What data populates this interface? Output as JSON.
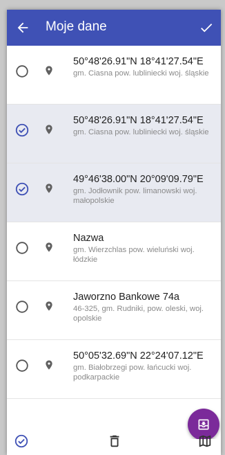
{
  "header": {
    "title": "Moje dane"
  },
  "locations": [
    {
      "title": "50°48'26.91\"N 18°41'27.54\"E",
      "subtitle": "gm. Ciasna pow. lubliniecki woj. śląskie",
      "selected": false
    },
    {
      "title": "50°48'26.91\"N 18°41'27.54\"E",
      "subtitle": "gm. Ciasna pow. lubliniecki woj. śląskie",
      "selected": true
    },
    {
      "title": "49°46'38.00\"N 20°09'09.79\"E",
      "subtitle": "gm. Jodłownik pow. limanowski woj. małopolskie",
      "selected": true
    },
    {
      "title": "Nazwa",
      "subtitle": "gm. Wierzchlas pow. wieluński woj. łódzkie",
      "selected": false
    },
    {
      "title": "Jaworzno Bankowe 74a",
      "subtitle": "46-325, gm. Rudniki, pow. oleski, woj. opolskie",
      "selected": false
    },
    {
      "title": "50°05'32.69\"N 22°24'07.12\"E",
      "subtitle": "gm. Białobrzegi pow. łańcucki woj. podkarpackie",
      "selected": false
    }
  ],
  "icons": {
    "back": "arrow-back-icon",
    "confirm": "check-icon",
    "pin": "location-pin-icon",
    "fab": "import-icon",
    "select_all": "check-circle-icon",
    "delete": "trash-icon",
    "map": "map-icon"
  },
  "colors": {
    "appbar": "#3f51b5",
    "selected_row": "#e8eaf1",
    "fab": "#7b2a9a",
    "accent": "#3f51b5"
  }
}
